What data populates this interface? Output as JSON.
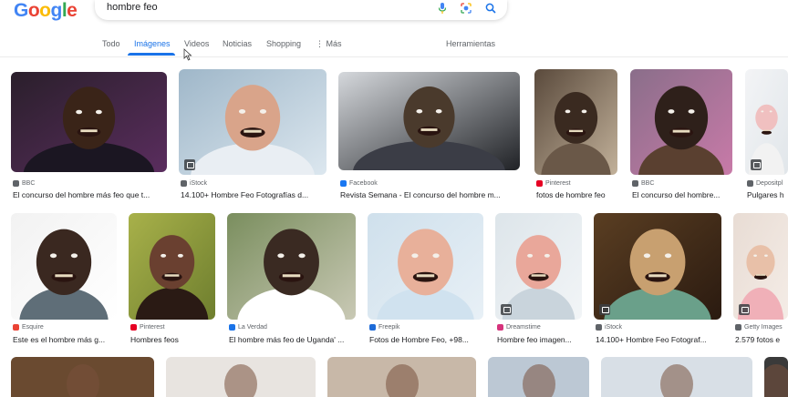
{
  "logo": {
    "letters": [
      "G",
      "o",
      "o",
      "g",
      "l",
      "e"
    ],
    "colors": [
      "#4285f4",
      "#ea4335",
      "#fbbc05",
      "#4285f4",
      "#34a853",
      "#ea4335"
    ]
  },
  "search": {
    "query": "hombre feo",
    "icons": [
      "microphone-icon",
      "lens-icon",
      "search-icon"
    ]
  },
  "tabs": [
    {
      "label": "Todo",
      "active": false
    },
    {
      "label": "Imágenes",
      "active": true
    },
    {
      "label": "Videos",
      "active": false
    },
    {
      "label": "Noticias",
      "active": false
    },
    {
      "label": "Shopping",
      "active": false
    },
    {
      "label": "⋮ Más",
      "active": false
    },
    {
      "label": "Herramientas",
      "active": false
    }
  ],
  "colors": {
    "accent": "#1a73e8",
    "text": "#202124",
    "secondary": "#5f6368"
  },
  "results": [
    {
      "source": "BBC",
      "caption": "El concurso del hombre más feo que t..."
    },
    {
      "source": "iStock",
      "caption": "14.100+ Hombre Feo Fotografías d..."
    },
    {
      "source": "Facebook",
      "caption": "Revista Semana - El concurso del hombre m..."
    },
    {
      "source": "Pinterest",
      "caption": "fotos de hombre feo"
    },
    {
      "source": "BBC",
      "caption": "El concurso del hombre..."
    },
    {
      "source": "Depositpl",
      "caption": "Pulgares h"
    },
    {
      "source": "Esquire",
      "caption": "Este es el hombre más g..."
    },
    {
      "source": "Pinterest",
      "caption": "Hombres feos"
    },
    {
      "source": "La Verdad",
      "caption": "El hombre más feo de Uganda' ..."
    },
    {
      "source": "Freepik",
      "caption": "Fotos de Hombre Feo, +98..."
    },
    {
      "source": "Dreamstime",
      "caption": "Hombre feo imagen..."
    },
    {
      "source": "iStock",
      "caption": "14.100+ Hombre Feo Fotograf..."
    },
    {
      "source": "Getty Images",
      "caption": "2.579 fotos e"
    }
  ]
}
